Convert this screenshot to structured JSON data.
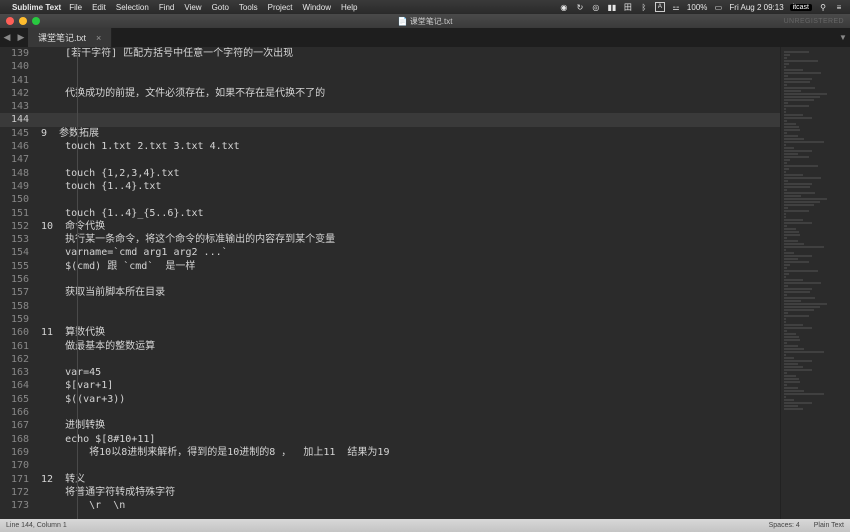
{
  "menubar": {
    "apple": "",
    "app": "Sublime Text",
    "menus": [
      "File",
      "Edit",
      "Selection",
      "Find",
      "View",
      "Goto",
      "Tools",
      "Project",
      "Window",
      "Help"
    ],
    "right": {
      "battery": "100%",
      "clock": "Fri Aug 2  09:13",
      "user": "itcast"
    }
  },
  "window": {
    "title": "课堂笔记.txt",
    "unregistered": "UNREGISTERED"
  },
  "tabs": {
    "nav_back": "◀",
    "nav_fwd": "▶",
    "active": {
      "label": "课堂笔记.txt",
      "close": "×"
    },
    "dropdown": "▼"
  },
  "editor": {
    "first_line_no": 139,
    "current_line_no": 144,
    "lines": [
      "    [若干字符] 匹配方括号中任意一个字符的一次出现",
      "",
      "",
      "    代换成功的前提，文件必须存在，如果不存在是代换不了的",
      "",
      "",
      "9  参数拓展",
      "    touch 1.txt 2.txt 3.txt 4.txt",
      "",
      "    touch {1,2,3,4}.txt",
      "    touch {1..4}.txt",
      "",
      "    touch {1..4}_{5..6}.txt",
      "10  命令代换",
      "    执行某一条命令，将这个命令的标准输出的内容存到某个变量",
      "    varname=`cmd arg1 arg2 ...`",
      "    $(cmd) 跟 `cmd`  是一样",
      "",
      "    获取当前脚本所在目录",
      "",
      "",
      "11  算数代换",
      "    做最基本的整数运算",
      "",
      "    var=45",
      "    $[var+1]",
      "    $((var+3))",
      "",
      "    进制转换",
      "    echo $[8#10+11]",
      "        将10以8进制来解析，得到的是10进制的8 ，  加上11  结果为19",
      "",
      "12  转义",
      "    将普通字符转成特殊字符",
      "        \\r  \\n"
    ]
  },
  "status": {
    "position": "Line 144, Column 1",
    "spaces": "Spaces: 4",
    "syntax": "Plain Text"
  }
}
